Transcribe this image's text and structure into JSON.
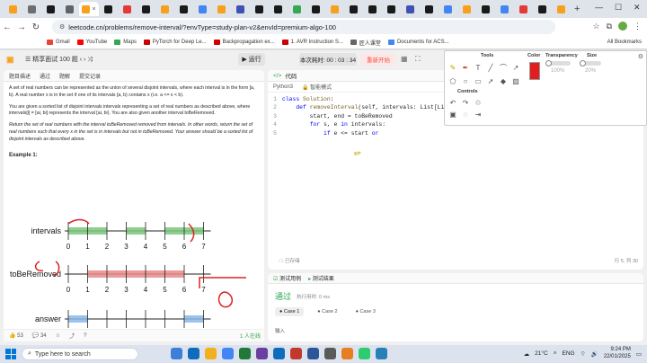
{
  "browser": {
    "url": "leetcode.cn/problems/remove-interval/?envType=study-plan-v2&envId=premium-algo-100",
    "tab_colors": [
      "#f89f1b",
      "#6e6e6e",
      "#1a1a1a",
      "#5f6368",
      "#f89f1b",
      "#1a1a1a",
      "#e53935",
      "#1a1a1a",
      "#f89f1b",
      "#1a1a1a",
      "#4285f4",
      "#f89f1b",
      "#3f51b5",
      "#1a1a1a",
      "#1a1a1a",
      "#34a853",
      "#1a1a1a",
      "#f89f1b",
      "#1a1a1a",
      "#1a1a1a",
      "#1a1a1a",
      "#3f51b5",
      "#1a1a1a",
      "#4285f4",
      "#f89f1b",
      "#1a1a1a",
      "#4285f4",
      "#e53935",
      "#1a1a1a",
      "#f89f1b"
    ],
    "bookmarks": [
      {
        "label": "Gmail",
        "color": "#ea4335"
      },
      {
        "label": "YouTube",
        "color": "#ff0000"
      },
      {
        "label": "Maps",
        "color": "#34a853"
      },
      {
        "label": "PyTorch for Deep Le...",
        "color": "#cc0000"
      },
      {
        "label": "Backpropagation ex...",
        "color": "#cc0000"
      },
      {
        "label": "1. AVR Instruction S...",
        "color": "#cc0000"
      },
      {
        "label": "匠人课堂",
        "color": "#666666"
      },
      {
        "label": "Documents for ACS...",
        "color": "#4285f4"
      }
    ],
    "all_bookmarks": "All Bookmarks"
  },
  "leetcode": {
    "problem_list": "精享面试 100 题",
    "run": "运行",
    "timer": "本次耗时: 00 : 03 : 34",
    "restart": "重新开始",
    "desc_tabs": [
      "题目描述",
      "通过",
      "题解",
      "提交记录"
    ],
    "desc": {
      "p1": "A set of real numbers can be represented as the union of several disjoint intervals, where each interval is in the form [a, b). A real number x is in the set if one of its intervals [a, b) contains x (i.e. a <= x < b).",
      "p2": "You are given a sorted list of disjoint intervals intervals representing a set of real numbers as described above, where intervals[i] = [ai, bi] represents the interval [ai, bi). You are also given another interval toBeRemoved.",
      "p3": "Return the set of real numbers with the interval toBeRemoved removed from intervals. In other words, return the set of real numbers such that every x in the set is in intervals but not in toBeRemoved. Your answer should be a sorted list of disjoint intervals as described above.",
      "example": "Example 1:",
      "labels": [
        "intervals",
        "toBeRemoved",
        "answer"
      ],
      "ticks": [
        "0",
        "1",
        "2",
        "3",
        "4",
        "5",
        "6",
        "7"
      ]
    },
    "footer": {
      "likes": "53",
      "comments": "34",
      "online": "1 人在线"
    },
    "code_tab": "代码",
    "lang": "Python3",
    "mode": "智能模式",
    "code_lines": [
      "class Solution:",
      "    def removeInterval(self, intervals: List[List[int]], toBeRemoved: List[int]) -> List[List[int]]:",
      "        start, end = toBeRemoved",
      "        for s, e in intervals:",
      "            if e <= start or"
    ],
    "saved": "已存储",
    "cursor": "行 5, 列 30",
    "test_tabs": [
      "测试用例",
      "测试结果"
    ],
    "passed": "通过",
    "runtime": "执行用时: 0 ms",
    "cases": [
      "Case 1",
      "Case 2",
      "Case 3"
    ],
    "input_label": "输入"
  },
  "draw_tools": {
    "tools": "Tools",
    "color": "Color",
    "transparency": "Transparency",
    "size": "Size",
    "controls": "Controls",
    "transparency_pct": "100%",
    "size_pct": "20%",
    "current_color": "#e21d1d"
  },
  "taskbar": {
    "search": "Type here to search",
    "weather": "21°C",
    "lang": "ENG",
    "time": "9:24 PM",
    "date": "22/01/2025"
  }
}
